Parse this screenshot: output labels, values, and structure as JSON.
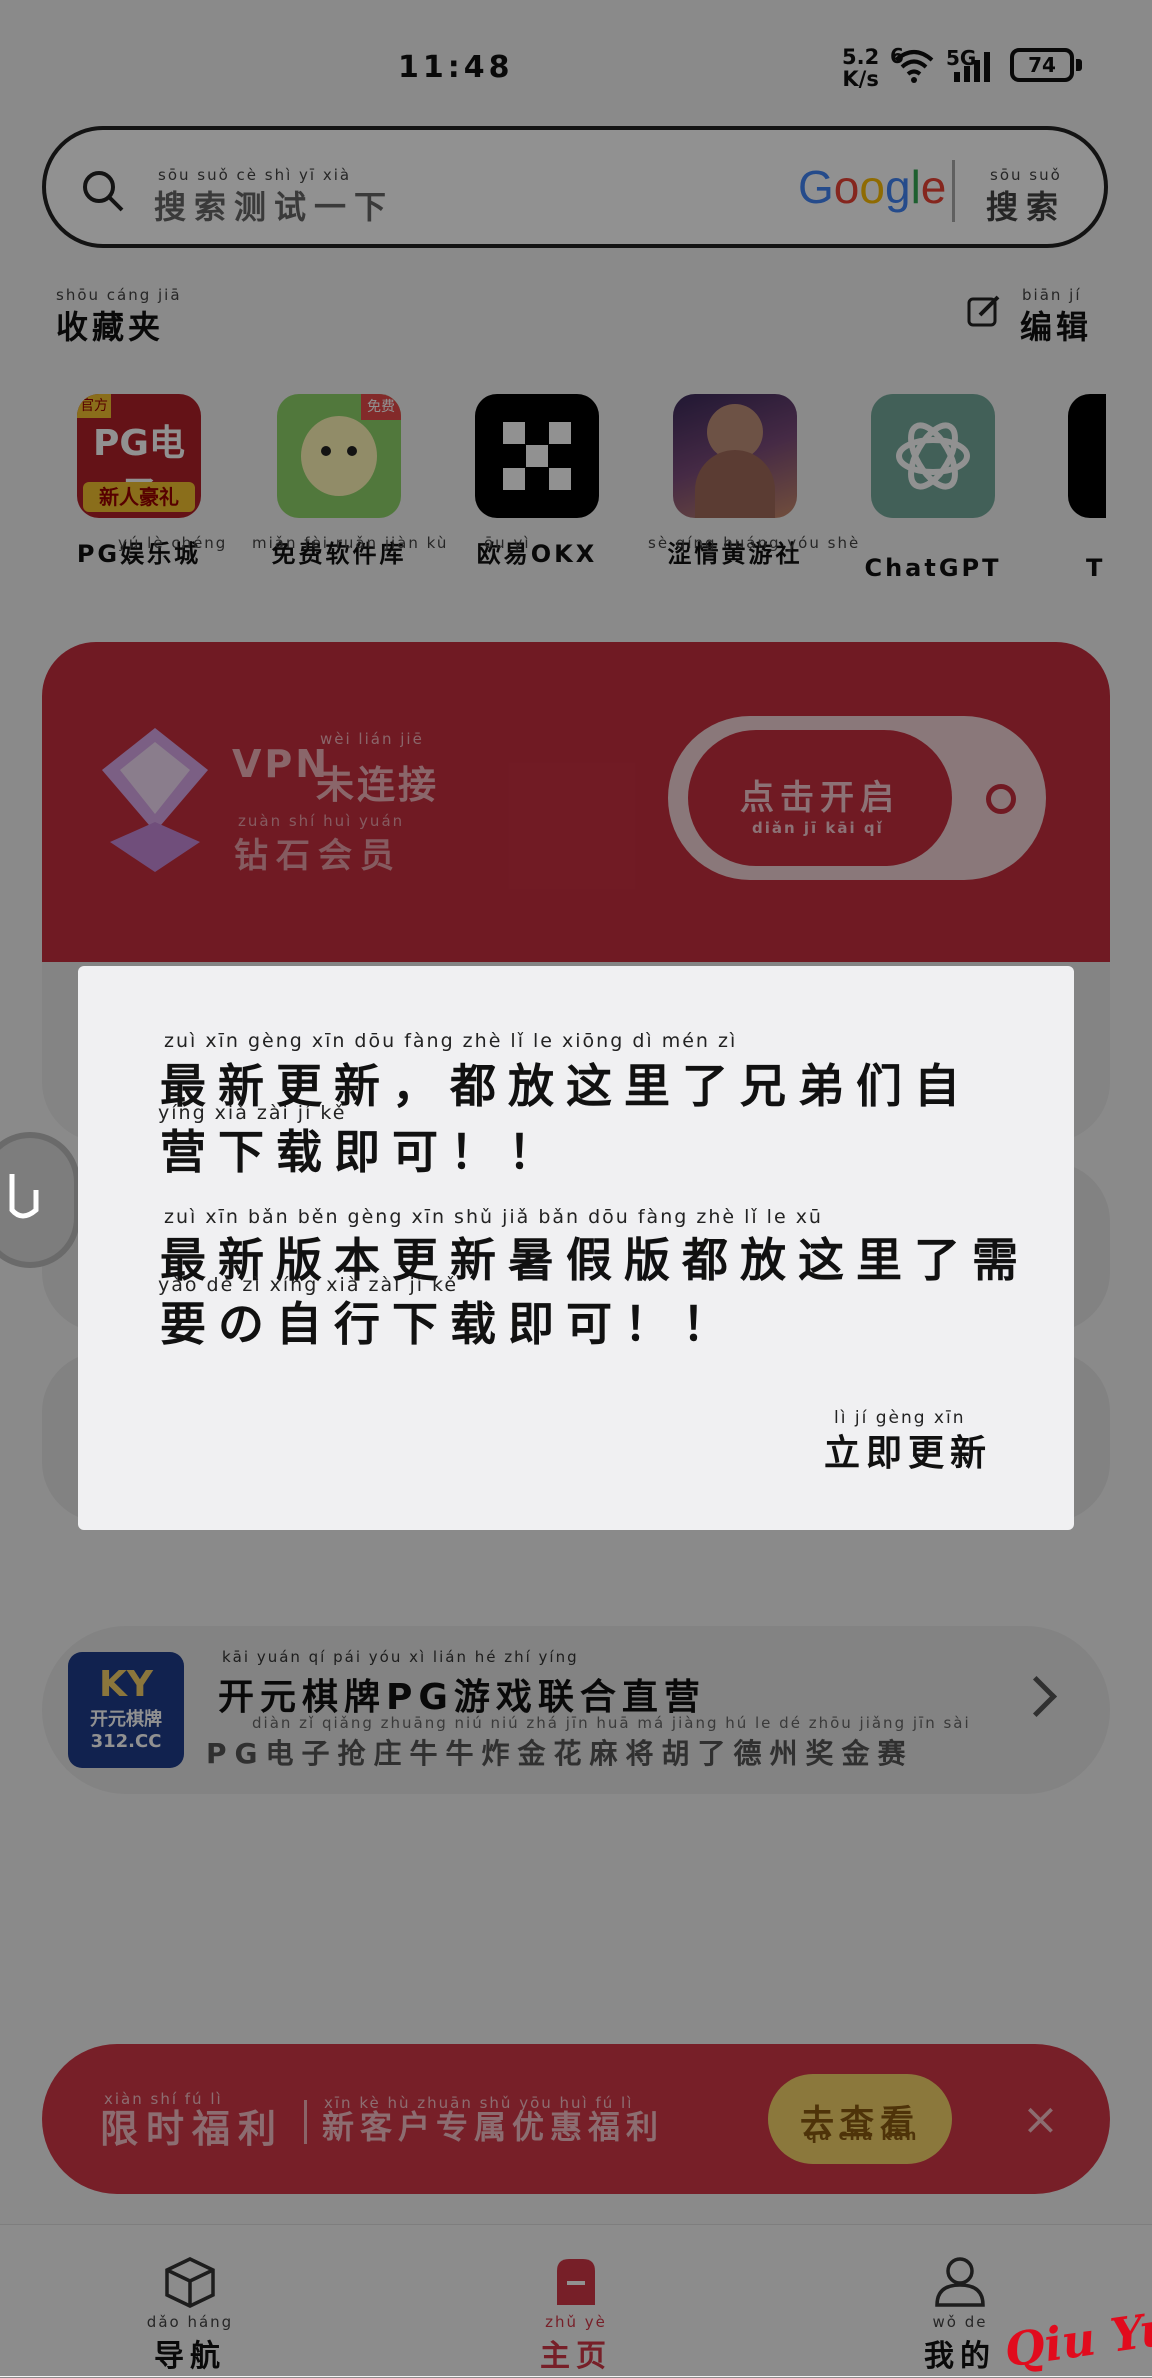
{
  "status": {
    "time": "11:48",
    "net_speed_value": "5.2",
    "net_speed_unit": "K/s",
    "signal_6": "6",
    "signal_5g": "5G",
    "battery": "74"
  },
  "search": {
    "placeholder_py": "sōu  suǒ  cè  shì  yī  xià",
    "placeholder": "搜索测试一下",
    "engine": "Google",
    "button_py": "sōu  suǒ",
    "button": "搜索"
  },
  "favorites": {
    "title_py": "shōu cáng jiā",
    "title": "收藏夹",
    "edit_py": "biān  jí",
    "edit": "编辑",
    "items": [
      {
        "label": "PG娱乐城",
        "py": "yú  lè  chéng",
        "icon": "pg-casino-icon"
      },
      {
        "label": "免费软件库",
        "py": "miǎn fèi ruǎn jiàn kù",
        "icon": "free-software-icon"
      },
      {
        "label": "欧易OKX",
        "py": "ōu  yì",
        "icon": "okx-icon"
      },
      {
        "label": "涩情黄游社",
        "py": "sè qíng huáng yóu shè",
        "icon": "game-club-icon"
      },
      {
        "label": "ChatGPT",
        "py": "",
        "icon": "chatgpt-icon"
      },
      {
        "label": "Ti",
        "py": "",
        "icon": "tiktok-icon"
      }
    ],
    "pg_badge": "官方",
    "pg_text": "PG电子",
    "pg_sub": "新人豪礼",
    "free_badge": "免费"
  },
  "vpn": {
    "title_prefix": "VPN",
    "title_py": "wèi  lián  jiē",
    "title": "未连接",
    "sub_py": "zuàn  shí  huì  yuán",
    "sub": "钻石会员",
    "button_py": "diǎn  jī  kāi  qǐ",
    "button": "点击开启"
  },
  "promo": {
    "title_py": "kāi yuán qí pái      yóu  xì  lián  hé  zhí  yíng",
    "title": "开元棋牌PG游戏联合直营",
    "sub_py": "diàn  zǐ  qiǎng zhuāng niú  niú  zhá  jīn  huā  má  jiàng  hú  le  dé zhōu jiǎng jīn  sài",
    "sub": "PG电子抢庄牛牛炸金花麻将胡了德州奖金赛",
    "logo_text": "开元棋牌",
    "logo_domain": "312.CC"
  },
  "banner": {
    "title_py": "xiàn  shí  fú  lì",
    "title": "限时福利",
    "sub_py": "xīn  kè  hù zhuān shǔ yōu huì  fú  lì",
    "sub": "新客户专属优惠福利",
    "button_py": "qù  chá  kàn",
    "button": "去查看",
    "close": "×"
  },
  "nav": {
    "items": [
      {
        "label": "导航",
        "py": "dǎo  háng",
        "icon": "cube-icon"
      },
      {
        "label": "主页",
        "py": "zhǔ  yè",
        "icon": "home-icon"
      },
      {
        "label": "我的",
        "py": "wǒ  de",
        "icon": "user-icon"
      }
    ]
  },
  "dialog": {
    "line1_py": "zuì   xīn  gèng  xīn        dōu  fàng  zhè   lǐ     le   xiōng   dì   mén   zì",
    "line1": "最新更新，都放这里了兄弟们自",
    "line2_py": "yíng  xià  zài   jí   kě",
    "line2": "营下载即可！！",
    "line3_py": "zuì   xīn  bǎn  běn  gèng  xīn    shǔ   jiǎ  bǎn   dōu  fàng  zhè   lǐ    le    xū",
    "line3": "最新版本更新暑假版都放这里了需",
    "line4_py": "yào   de    zì  xíng  xià  zài   jí   kě",
    "line4": "要の自行下载即可！！",
    "update_py": "lì   jí  gèng  xīn",
    "update": "立即更新"
  },
  "watermark": "Qiu Yue",
  "colors": {
    "accent_red": "#c62f3f",
    "banner_red": "#d23847",
    "button_yellow": "#f5d36a",
    "dialog_bg": "#f0f0f2"
  }
}
